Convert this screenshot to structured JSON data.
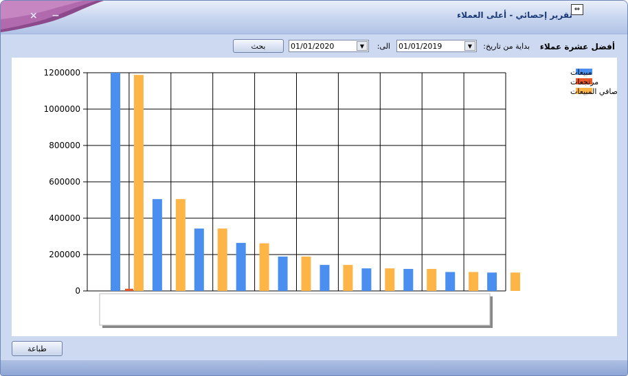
{
  "window": {
    "title": "تقرير إحصائي - أعلى العملاء",
    "resize_glyph": "⇔",
    "min_glyph": "−",
    "close_glyph": "×"
  },
  "toolbar": {
    "heading": "أفضل عشرة عملاء",
    "from_label": "بداية من تاريخ:",
    "from_date": "01/01/2019",
    "to_label": "الى:",
    "to_date": "01/01/2020",
    "search_label": "بحث",
    "dropdown_glyph": "▼"
  },
  "footer": {
    "print_label": "طباعة"
  },
  "colors": {
    "sales": "#4a8ff0",
    "returns": "#e8582a",
    "net": "#fdb547"
  },
  "chart_data": {
    "type": "bar",
    "categories": [
      "",
      "",
      "",
      "",
      "",
      "",
      "",
      "",
      "",
      ""
    ],
    "series": [
      {
        "name": "مبيعات",
        "values": [
          1200000,
          505000,
          343000,
          264000,
          189000,
          143000,
          124000,
          121000,
          104000,
          101000
        ]
      },
      {
        "name": "مرتجعات",
        "values": [
          12000,
          0,
          0,
          0,
          0,
          0,
          0,
          0,
          0,
          0
        ]
      },
      {
        "name": "صافي المبيعات",
        "values": [
          1188000,
          505000,
          343000,
          262000,
          189000,
          143000,
          124000,
          121000,
          104000,
          101000
        ]
      }
    ],
    "yticks": [
      "1200000",
      "1000000",
      "800000",
      "600000",
      "400000",
      "200000",
      "0"
    ],
    "ylim": [
      0,
      1200000
    ],
    "grid": true,
    "legend": "top-right"
  }
}
